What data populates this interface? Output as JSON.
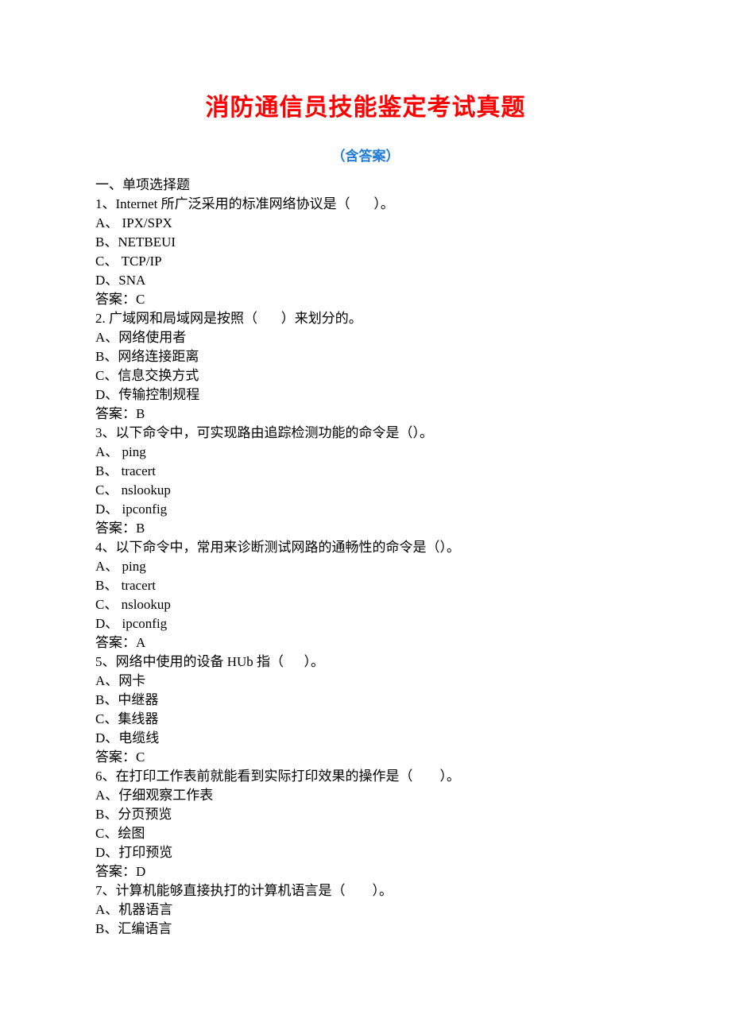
{
  "title": "消防通信员技能鉴定考试真题",
  "subtitle": "（含答案）",
  "section_header": "一、单项选择题",
  "questions": [
    {
      "stem": "1、Internet 所广泛采用的标准网络协议是（       ）。",
      "options": [
        "A、 IPX/SPX",
        "B、NETBEUI",
        "C、 TCP/IP",
        "D、SNA"
      ],
      "answer": "答案：C"
    },
    {
      "stem": "2. 广域网和局域网是按照（       ）来划分的。",
      "options": [
        "A、网络使用者",
        "B、网络连接距离",
        "C、信息交换方式",
        "D、传输控制规程"
      ],
      "answer": "答案：B"
    },
    {
      "stem": "3、以下命令中，可实现路由追踪检测功能的命令是（）。",
      "options": [
        "A、 ping",
        "B、 tracert",
        "C、 nslookup",
        "D、 ipconfig"
      ],
      "answer": "答案：B"
    },
    {
      "stem": "4、以下命令中，常用来诊断测试网路的通畅性的命令是（）。",
      "options": [
        "A、 ping",
        "B、 tracert",
        "C、 nslookup",
        "D、 ipconfig"
      ],
      "answer": "答案：A"
    },
    {
      "stem": "5、网络中使用的设备 HUb 指（      ）。",
      "options": [
        "A、网卡",
        "B、中继器",
        "C、集线器",
        "D、电缆线"
      ],
      "answer": "答案：C"
    },
    {
      "stem": "6、在打印工作表前就能看到实际打印效果的操作是（        ）。",
      "options": [
        "A、仔细观察工作表",
        "B、分页预览",
        "C、绘图",
        "D、打印预览"
      ],
      "answer": "答案：D"
    },
    {
      "stem": "7、计算机能够直接执打的计算机语言是（        ）。",
      "options": [
        "A、机器语言",
        "B、汇编语言"
      ],
      "answer": null
    }
  ]
}
